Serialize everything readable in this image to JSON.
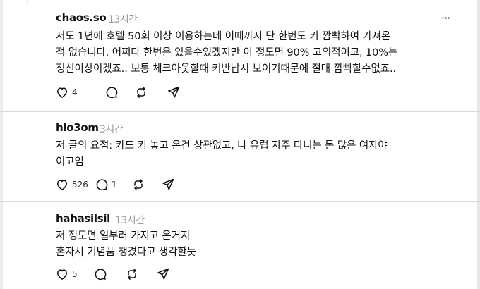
{
  "posts": [
    {
      "username": "chaos.so",
      "time": "13시간",
      "more": "···",
      "lines": [
        "저도 1년에 호텔 50회 이상 이용하는데 이때까지 단 한번도 키 깜빡하여 가져온",
        "적 없습니다. 어쩌다 한번은 있을수있겠지만 이 정도면 90% 고의적이고, 10%는",
        "정신이상이겠죠.. 보통 체크아웃할때 키반납시 보이기때문에 절대 깜빡할수없죠.."
      ],
      "like_count": "4",
      "reply_count": "",
      "icons": [
        "heart-icon",
        "comment-icon",
        "repost-icon",
        "share-icon"
      ]
    },
    {
      "username": "hlo3om",
      "time": "3시간",
      "more": "",
      "lines": [
        "저 글의 요점: 카드 키 놓고 온건 상관없고, 나 유럽 자주 다니는 돈 많은 여자야",
        "이고임"
      ],
      "like_count": "526",
      "reply_count": "1",
      "icons": [
        "heart-icon",
        "comment-icon",
        "repost-icon",
        "share-icon"
      ]
    },
    {
      "username": "hahasilsil",
      "time": "13시간",
      "more": "",
      "lines": [
        "저 정도면 일부러 가지고 온거지",
        "혼자서 기념품 챙겼다고 생각할듯"
      ],
      "like_count": "5",
      "reply_count": "",
      "icons": [
        "heart-icon",
        "comment-icon",
        "repost-icon",
        "share-icon"
      ]
    }
  ]
}
